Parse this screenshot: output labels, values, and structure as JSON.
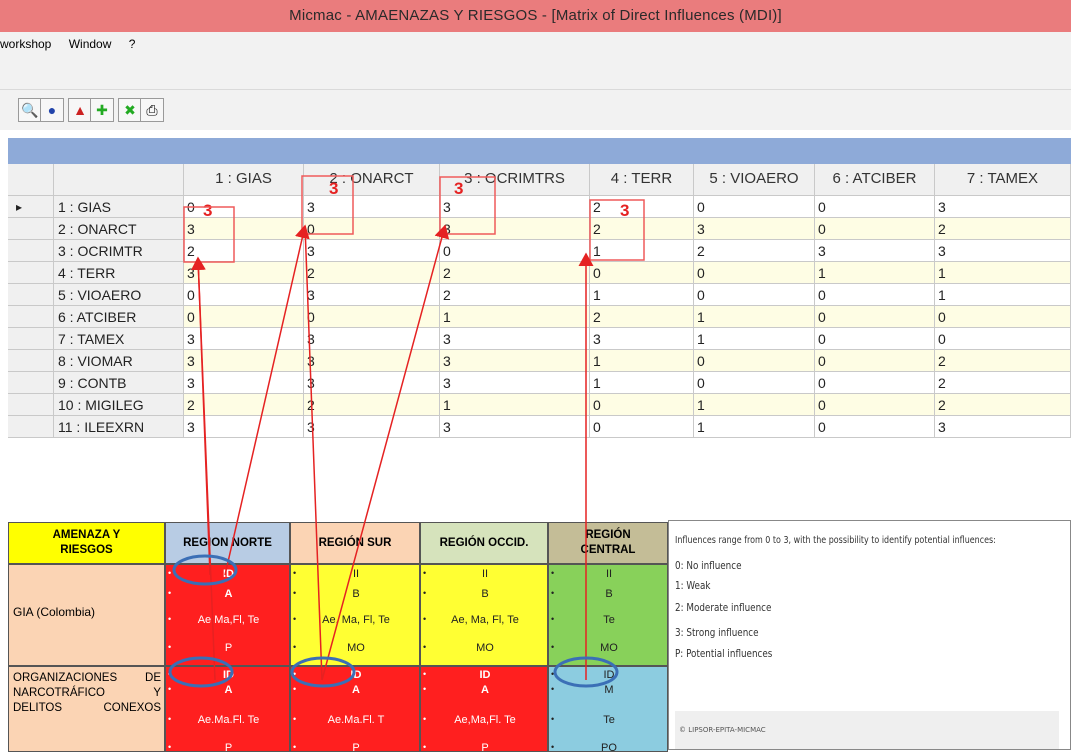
{
  "window": {
    "title": "Micmac  -  AMAENAZAS Y RIESGOS - [Matrix of Direct Influences (MDI)]"
  },
  "menu": [
    "workshop",
    "Window",
    "?"
  ],
  "toolbar": {
    "icons": [
      "printer-preview-icon",
      "import-icon",
      "export-icon",
      "add-green-icon",
      "remove-green-icon",
      "print-icon"
    ]
  },
  "matrix": {
    "columns": [
      "1 : GIAS",
      "2 : ONARCT",
      "3 : OCRIMTRS",
      "4 : TERR",
      "5 : VIOAERO",
      "6 : ATCIBER",
      "7 : TAMEX"
    ],
    "rows": [
      {
        "label": "1 : GIAS",
        "values": [
          "0",
          "3",
          "3",
          "2",
          "0",
          "0",
          "3"
        ]
      },
      {
        "label": "2 : ONARCT",
        "values": [
          "3",
          "0",
          "3",
          "2",
          "3",
          "0",
          "2"
        ]
      },
      {
        "label": "3 : OCRIMTR",
        "values": [
          "2",
          "3",
          "0",
          "1",
          "2",
          "3",
          "3"
        ]
      },
      {
        "label": "4 : TERR",
        "values": [
          "3",
          "2",
          "2",
          "0",
          "0",
          "1",
          "1"
        ]
      },
      {
        "label": "5 : VIOAERO",
        "values": [
          "0",
          "3",
          "2",
          "1",
          "0",
          "0",
          "1"
        ]
      },
      {
        "label": "6 : ATCIBER",
        "values": [
          "0",
          "0",
          "1",
          "2",
          "1",
          "0",
          "0"
        ]
      },
      {
        "label": "7 : TAMEX",
        "values": [
          "3",
          "3",
          "3",
          "3",
          "1",
          "0",
          "0"
        ]
      },
      {
        "label": "8 : VIOMAR",
        "values": [
          "3",
          "3",
          "3",
          "1",
          "0",
          "0",
          "2"
        ]
      },
      {
        "label": "9 : CONTB",
        "values": [
          "3",
          "3",
          "3",
          "1",
          "0",
          "0",
          "2"
        ]
      },
      {
        "label": "10 : MIGILEG",
        "values": [
          "2",
          "2",
          "1",
          "0",
          "1",
          "0",
          "2"
        ]
      },
      {
        "label": "11 : ILEEXRN",
        "values": [
          "3",
          "3",
          "3",
          "0",
          "1",
          "0",
          "3"
        ]
      }
    ],
    "annotations": [
      "3",
      "3",
      "3",
      "3",
      "2"
    ]
  },
  "regions": {
    "corner": "AMENAZA Y RIESGOS",
    "headers": [
      "REGION NORTE",
      "REGIÓN SUR",
      "REGIÓN OCCID.",
      "REGIÓN CENTRAL"
    ],
    "header_colors": [
      "#b8cce4",
      "#fbd4b4",
      "#d6e3bc",
      "#c4bd97"
    ],
    "rows": [
      {
        "label": "GIA (Colombia)",
        "cells": [
          {
            "lines": [
              "ID",
              "A",
              "Ae,Ma,Fl, Te",
              "P"
            ],
            "color": "#ff1f1f"
          },
          {
            "lines": [
              "II",
              "B",
              "Ae, Ma, Fl, Te",
              "MO"
            ],
            "color": "#ffff33"
          },
          {
            "lines": [
              "II",
              "B",
              "Ae, Ma, Fl, Te",
              "MO"
            ],
            "color": "#ffff33"
          },
          {
            "lines": [
              "II",
              "B",
              "Te",
              "MO"
            ],
            "color": "#88d15a"
          }
        ]
      },
      {
        "label": "ORGANIZACIONES DE NARCOTRÁFICO Y DELITOS CONEXOS",
        "cells": [
          {
            "lines": [
              "ID",
              "A",
              "Ae.Ma.Fl. Te",
              "P"
            ],
            "color": "#ff1f1f"
          },
          {
            "lines": [
              "ID",
              "A",
              "Ae.Ma.Fl. T",
              "P"
            ],
            "color": "#ff1f1f"
          },
          {
            "lines": [
              "ID",
              "A",
              "Ae,Ma,Fl. Te",
              "P"
            ],
            "color": "#ff1f1f"
          },
          {
            "lines": [
              "ID",
              "M",
              "Te",
              "PO"
            ],
            "color": "#8ccce0"
          }
        ]
      }
    ]
  },
  "legend": {
    "title": "Influences range from 0 to 3, with the possibility to identify potential influences:",
    "items": [
      "0: No influence",
      "1: Weak",
      "2: Moderate influence",
      "3: Strong influence",
      "P: Potential influences"
    ],
    "footer": "© LIPSOR-EPITA-MICMAC"
  }
}
